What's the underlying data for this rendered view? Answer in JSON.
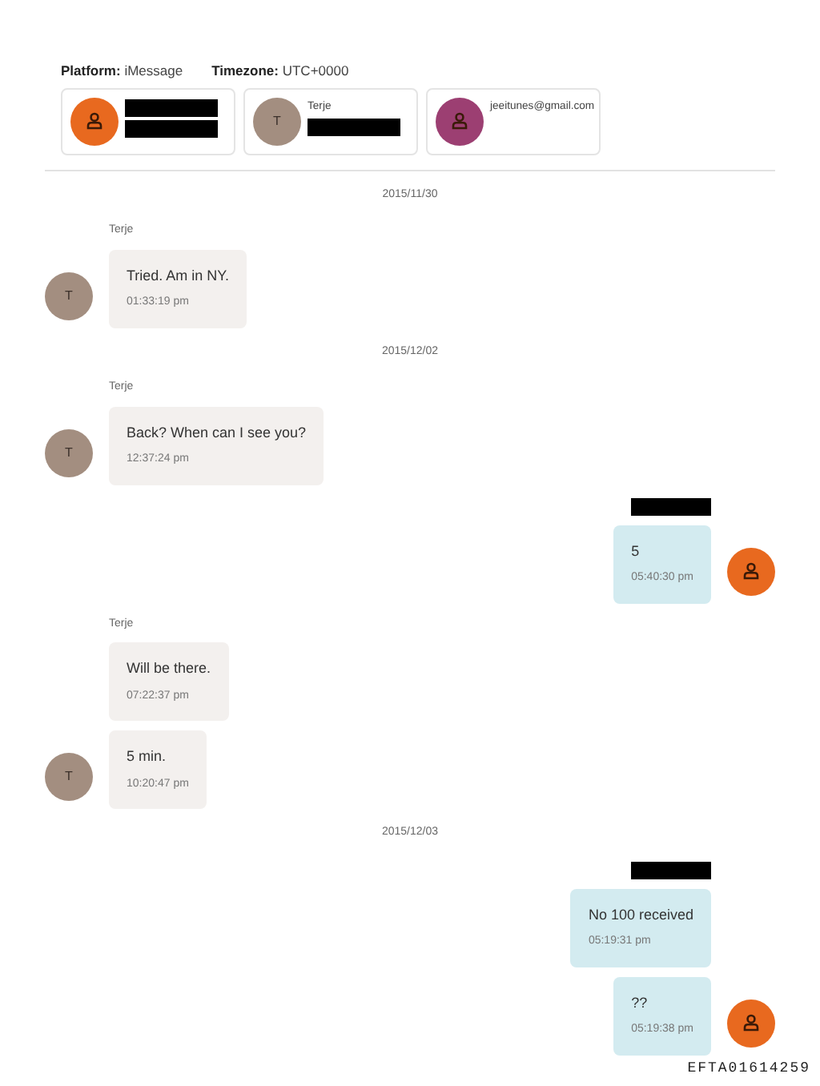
{
  "header": {
    "platform_label": "Platform:",
    "platform": "iMessage",
    "timezone_label": "Timezone:",
    "timezone": "UTC+0000"
  },
  "participants": [
    {
      "avatar": {
        "kind": "person",
        "color": "#e8691f"
      },
      "lines": [
        {
          "kind": "redacted"
        },
        {
          "kind": "redacted"
        }
      ]
    },
    {
      "avatar": {
        "kind": "letter",
        "letter": "T",
        "color": "#a38e80"
      },
      "lines": [
        {
          "kind": "text",
          "text": "Terje"
        },
        {
          "kind": "redacted"
        }
      ]
    },
    {
      "avatar": {
        "kind": "person",
        "color": "#9c3f72"
      },
      "lines": [
        {
          "kind": "text",
          "text": "jeeitunes@gmail.com"
        }
      ]
    }
  ],
  "days": [
    {
      "date": "2015/11/30",
      "groups": [
        {
          "kind": "incoming",
          "sender": {
            "kind": "text",
            "text": "Terje"
          },
          "avatar": {
            "kind": "letter",
            "letter": "T",
            "color": "#a38e80"
          },
          "messages": [
            {
              "text": "Tried. Am in NY.",
              "time": "01:33:19 pm"
            }
          ]
        }
      ]
    },
    {
      "date": "2015/12/02",
      "groups": [
        {
          "kind": "incoming",
          "sender": {
            "kind": "text",
            "text": "Terje"
          },
          "avatar": {
            "kind": "letter",
            "letter": "T",
            "color": "#a38e80"
          },
          "messages": [
            {
              "text": "Back? When can I see you?",
              "time": "12:37:24 pm"
            }
          ]
        },
        {
          "kind": "outgoing",
          "sender": {
            "kind": "redacted"
          },
          "avatar": {
            "kind": "person",
            "color": "#e8691f"
          },
          "messages": [
            {
              "text": "5",
              "time": "05:40:30 pm"
            }
          ]
        },
        {
          "kind": "incoming",
          "sender": {
            "kind": "text",
            "text": "Terje"
          },
          "avatar": {
            "kind": "letter",
            "letter": "T",
            "color": "#a38e80"
          },
          "messages": [
            {
              "text": "Will be there.",
              "time": "07:22:37 pm"
            },
            {
              "text": "5 min.",
              "time": "10:20:47 pm"
            }
          ]
        }
      ]
    },
    {
      "date": "2015/12/03",
      "groups": [
        {
          "kind": "outgoing",
          "sender": {
            "kind": "redacted"
          },
          "avatar": {
            "kind": "person",
            "color": "#e8691f"
          },
          "messages": [
            {
              "text": "No 100 received",
              "time": "05:19:31 pm"
            },
            {
              "text": "??",
              "time": "05:19:38 pm"
            }
          ]
        }
      ]
    }
  ],
  "footer": "EFTA01614259"
}
